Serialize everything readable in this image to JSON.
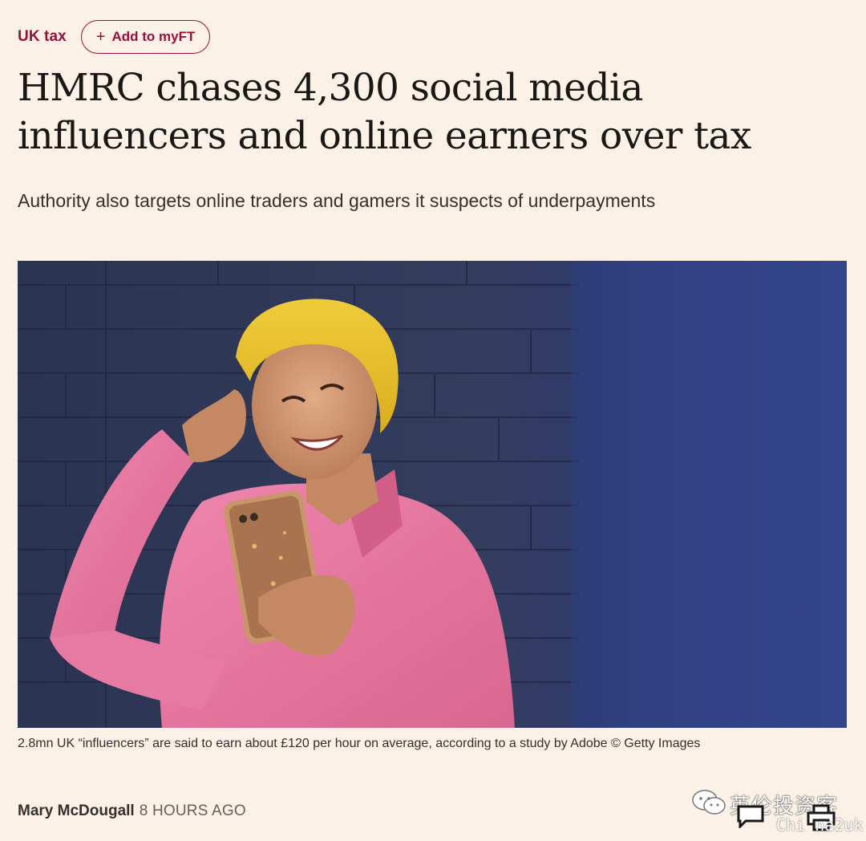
{
  "topic": {
    "label": "UK tax",
    "myft_button_label": "Add to myFT",
    "myft_icon": "plus-icon"
  },
  "article": {
    "headline": "HMRC chases 4,300 social media influencers and online earners over tax",
    "standfirst": "Authority also targets online traders and gamers it suspects of underpayments",
    "image": {
      "description_icon": "influencer-photo",
      "caption": "2.8mn UK “influencers” are said to earn about £120 per hour on average, according to a study by Adobe © Getty Images"
    },
    "byline": {
      "author": "Mary McDougall",
      "time": "8 HOURS AGO"
    }
  },
  "watermark": {
    "title": "英伦投资客",
    "subtitle": "Chi na2uk",
    "icons": [
      "wechat-icon",
      "comment-icon",
      "print-icon"
    ]
  },
  "colors": {
    "page_background": "#fcf1e6",
    "accent_claret": "#990f3d",
    "headline_text": "#1a1817",
    "body_text": "#33302e",
    "muted_text": "#66605c"
  }
}
